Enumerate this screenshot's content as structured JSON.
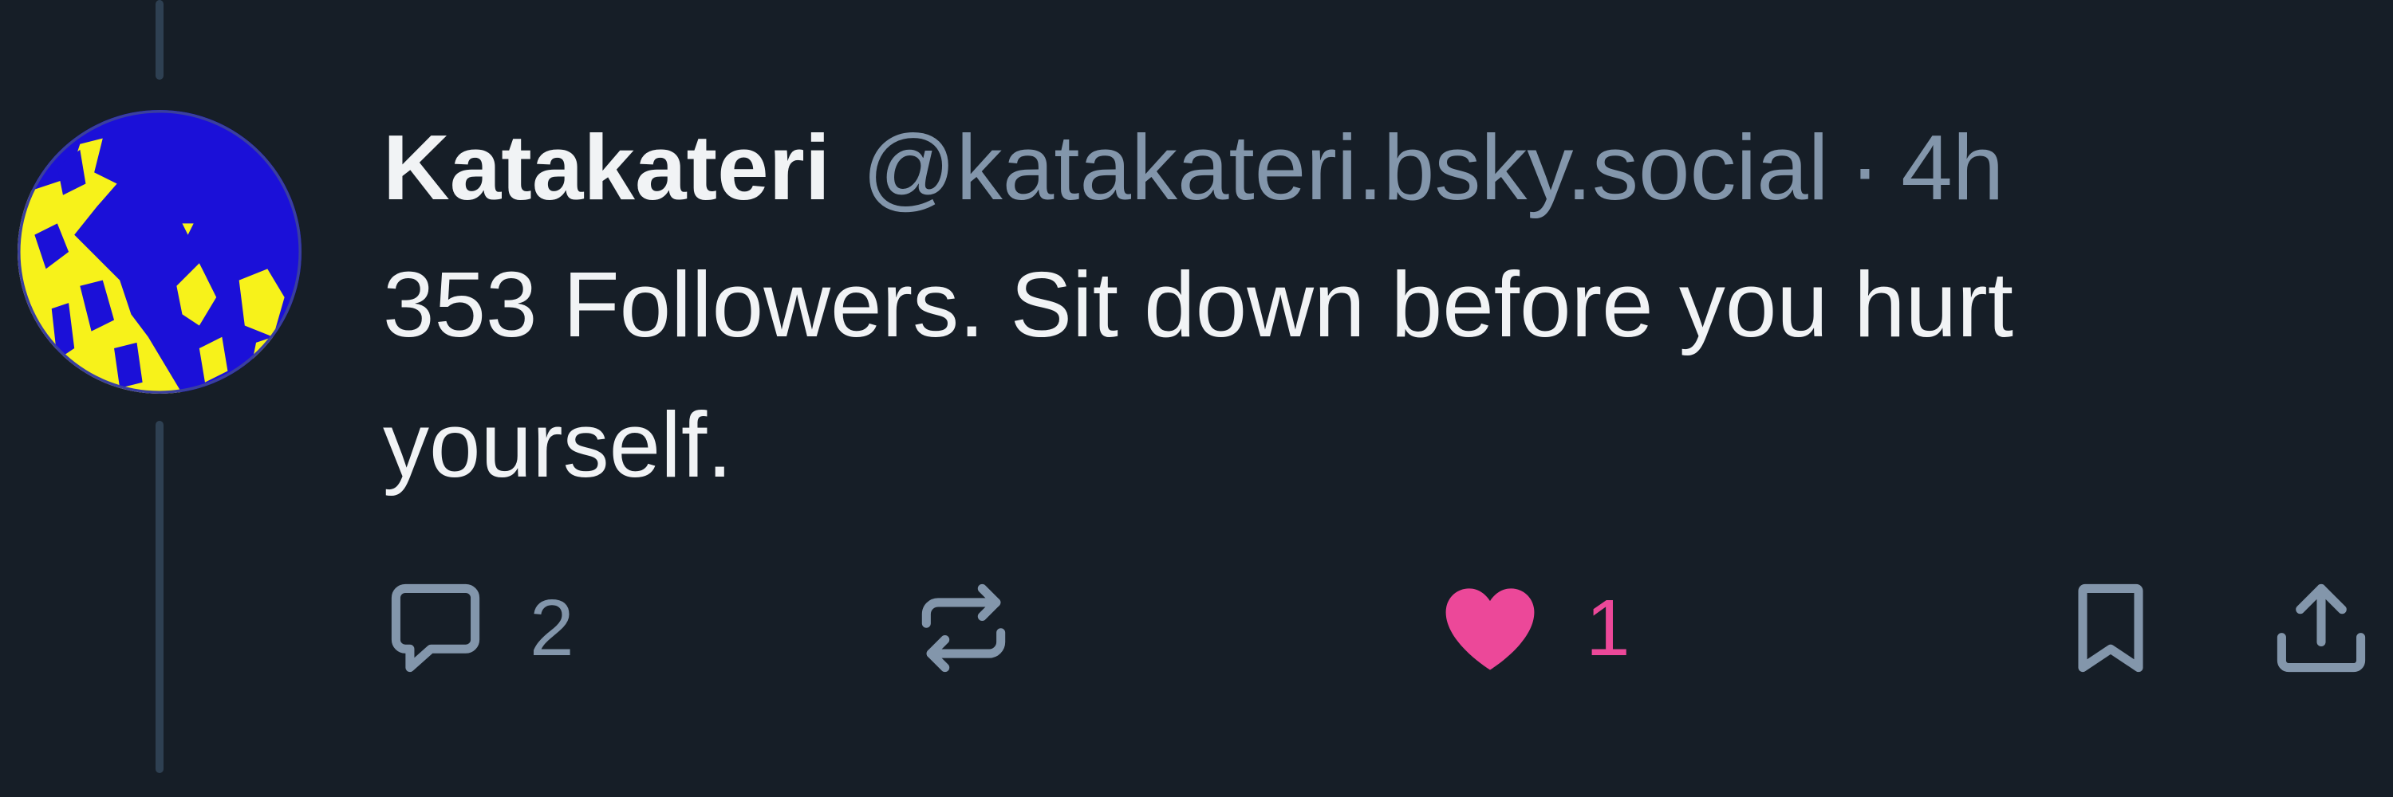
{
  "post": {
    "author": {
      "display_name": "Katakateri",
      "handle": "@katakateri.bsky.social",
      "avatar_colors": [
        "#1b10d8",
        "#f7f21a"
      ]
    },
    "separator": "·",
    "timestamp": "4h",
    "text": "353 Followers. Sit down before you hurt yourself.",
    "actions": {
      "reply": {
        "icon": "speech-bubble-icon",
        "count": "2"
      },
      "repost": {
        "icon": "repost-arrows-icon"
      },
      "like": {
        "icon": "heart-icon",
        "count": "1",
        "liked": true,
        "color": "#ec4899"
      },
      "bookmark": {
        "icon": "bookmark-icon"
      },
      "share": {
        "icon": "share-upload-icon"
      }
    }
  },
  "theme": {
    "background": "#161e27",
    "muted_text": "#8396ab",
    "thread_line": "#2e4052"
  }
}
